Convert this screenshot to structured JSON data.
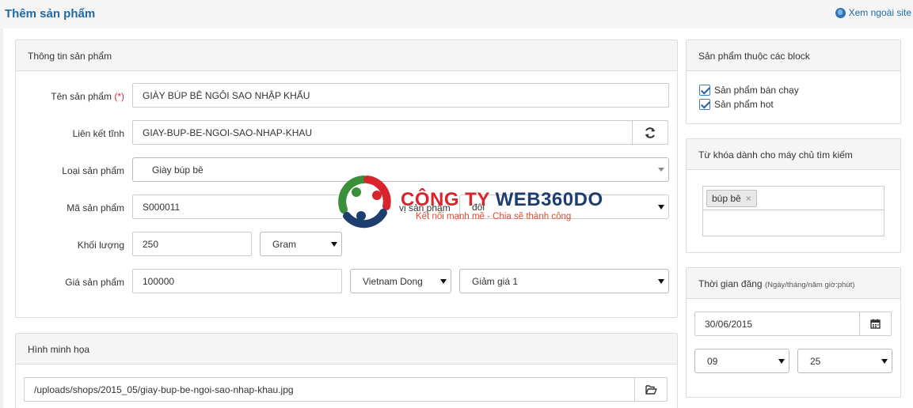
{
  "header": {
    "title": "Thêm sản phẩm",
    "view_site": "Xem ngoài site"
  },
  "product_info": {
    "heading": "Thông tin sản phẩm",
    "name_label": "Tên sản phẩm",
    "required_mark": "(*)",
    "name_value": "GIÀY BÚP BÊ NGÔI SAO NHẬP KHẨU",
    "link_label": "Liên kết tĩnh",
    "link_value": "GIAY-BUP-BE-NGOI-SAO-NHAP-KHAU",
    "type_label": "Loại sản phẩm",
    "type_value": "Giày búp bê",
    "code_label": "Mã sản phẩm",
    "code_value": "S000011",
    "unit_label": "vị sản phẩm",
    "unit_value": "đôi",
    "weight_label": "Khối lượng",
    "weight_value": "250",
    "weight_unit": "Gram",
    "price_label": "Giá sản phẩm",
    "price_value": "100000",
    "currency": "Vietnam Dong",
    "discount": "Giảm giá 1"
  },
  "illustration": {
    "heading": "Hình minh họa",
    "path_value": "/uploads/shops/2015_05/giay-bup-be-ngoi-sao-nhap-khau.jpg"
  },
  "blocks": {
    "heading": "Sản phẩm thuộc các block",
    "items": [
      {
        "label": "Sản phẩm bán chạy",
        "checked": true
      },
      {
        "label": "Sản phẩm hot",
        "checked": true
      }
    ]
  },
  "keywords": {
    "heading": "Từ khóa dành cho máy chủ tìm kiếm",
    "tags": [
      "búp bê"
    ],
    "remove_symbol": "×"
  },
  "publish_time": {
    "heading": "Thời gian đăng",
    "heading_hint": "(Ngày/tháng/năm giờ:phút)",
    "date_value": "30/06/2015",
    "hour_value": "09",
    "minute_value": "25"
  },
  "watermark": {
    "brand_prefix": "CÔNG TY ",
    "brand_suffix": "WEB360DO",
    "slogan": "Kết nối mạnh mẽ - Chia sẽ thành công"
  },
  "colors": {
    "title_blue": "#1f6aa5",
    "required_red": "#d9232d",
    "watermark_red": "#d8242a",
    "watermark_navy": "#1d3e6e"
  },
  "icons": {
    "view_site": "globe-icon",
    "refresh": "refresh-icon",
    "calendar": "calendar-icon",
    "folder": "folder-open-icon",
    "check": "check-icon"
  }
}
